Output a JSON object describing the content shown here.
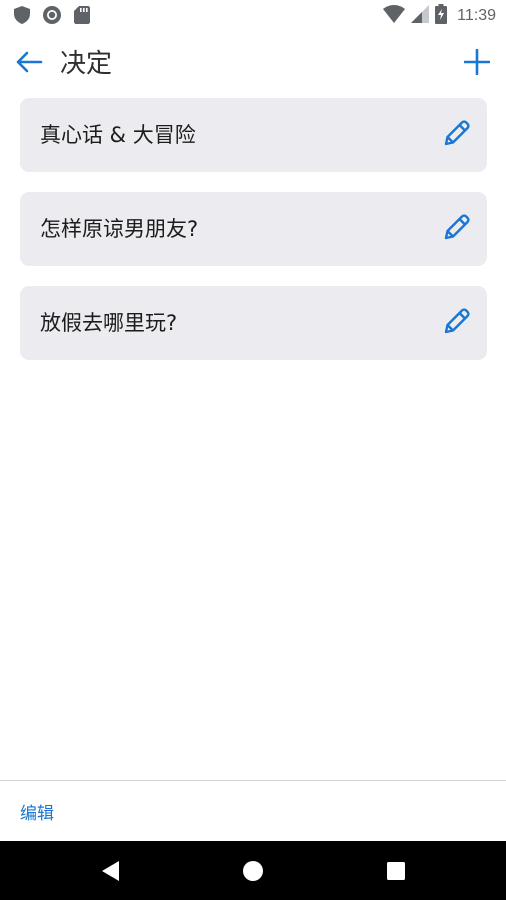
{
  "status_bar": {
    "time": "11:39",
    "left_icons": [
      "shield-icon",
      "record-icon",
      "sd-card-icon"
    ],
    "right_icons": [
      "wifi-icon",
      "cellular-signal-icon",
      "battery-charging-icon"
    ]
  },
  "app_bar": {
    "title": "决定",
    "back_icon": "arrow-left-icon",
    "add_icon": "plus-icon"
  },
  "decisions": [
    {
      "label": "真心话 & 大冒险",
      "action_icon": "pencil-icon"
    },
    {
      "label": "怎样原谅男朋友?",
      "action_icon": "pencil-icon"
    },
    {
      "label": "放假去哪里玩?",
      "action_icon": "pencil-icon"
    }
  ],
  "bottom_bar": {
    "edit_label": "编辑"
  },
  "nav_bar": {
    "buttons": [
      "back-triangle-icon",
      "home-circle-icon",
      "recents-square-icon"
    ]
  },
  "colors": {
    "accent": "#1976d2",
    "card_bg": "#ececf0",
    "text": "#1c1c1c",
    "status_icons": "#5f6368",
    "nav_bg": "#000000"
  }
}
